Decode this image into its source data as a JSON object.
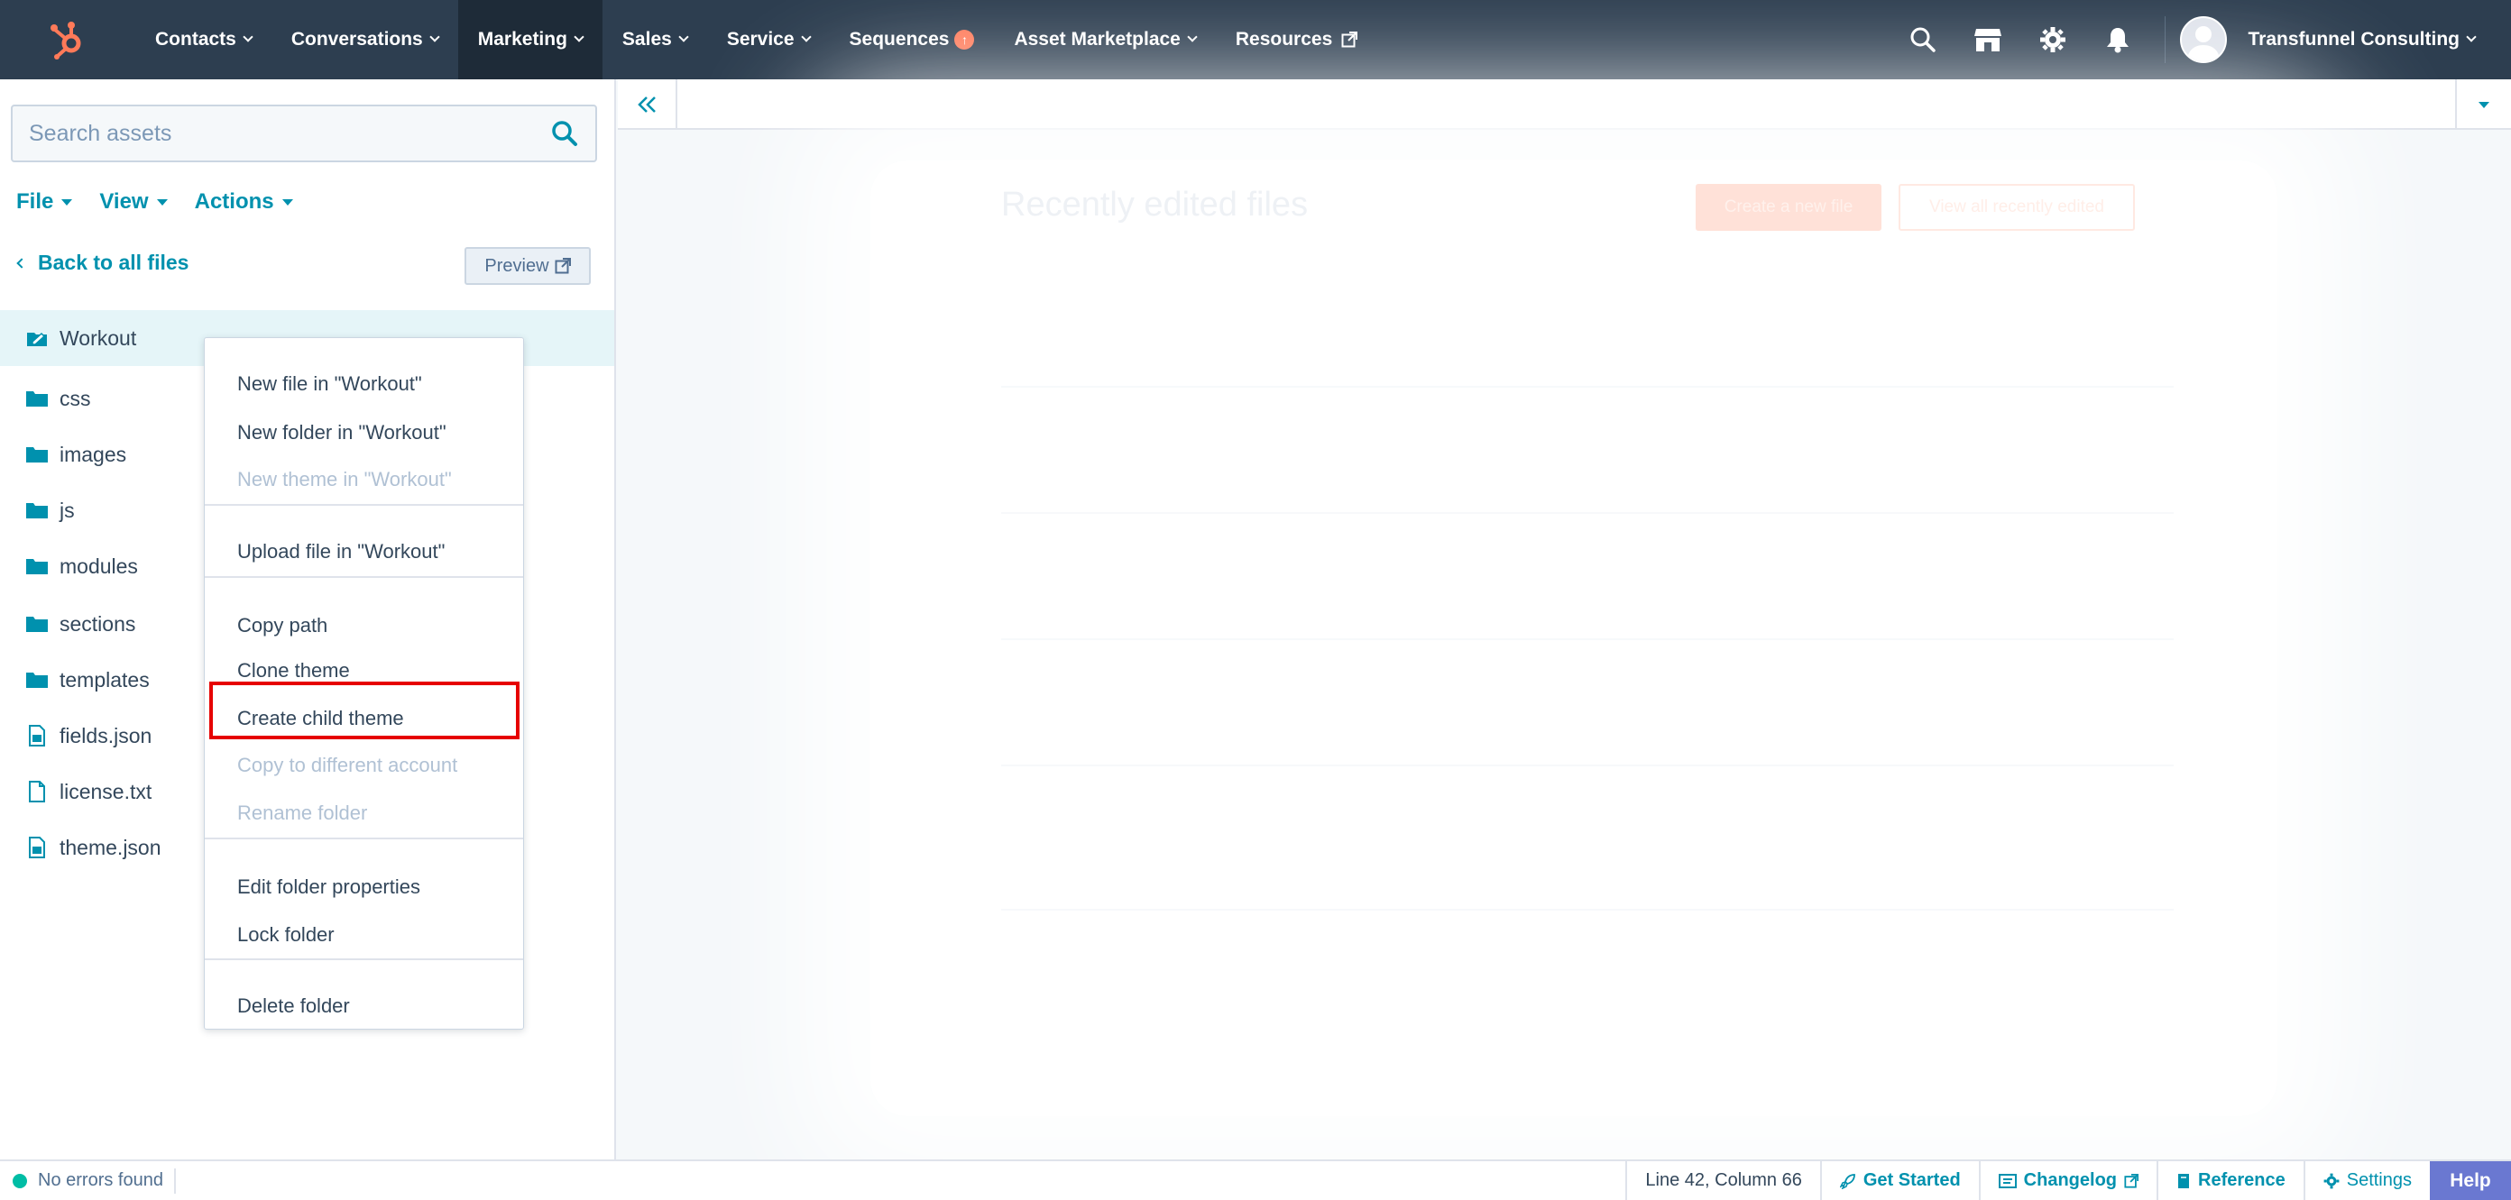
{
  "nav": {
    "items": [
      {
        "label": "Contacts",
        "caret": true
      },
      {
        "label": "Conversations",
        "caret": true
      },
      {
        "label": "Marketing",
        "caret": true,
        "active": true
      },
      {
        "label": "Sales",
        "caret": true
      },
      {
        "label": "Service",
        "caret": true
      },
      {
        "label": "Sequences",
        "badge": true
      },
      {
        "label": "Asset Marketplace",
        "caret": true
      },
      {
        "label": "Resources",
        "external": true
      }
    ],
    "account_name": "Transfunnel Consulting",
    "icons": [
      "search-icon",
      "marketplace-icon",
      "settings-gear-icon",
      "notifications-bell-icon"
    ]
  },
  "sidebar": {
    "search_placeholder": "Search assets",
    "menus": [
      "File",
      "View",
      "Actions"
    ],
    "back_label": "Back to all files",
    "preview_label": "Preview",
    "tree": [
      {
        "label": "Workout",
        "type": "theme"
      },
      {
        "label": "css",
        "type": "folder"
      },
      {
        "label": "images",
        "type": "folder"
      },
      {
        "label": "js",
        "type": "folder"
      },
      {
        "label": "modules",
        "type": "folder"
      },
      {
        "label": "sections",
        "type": "folder"
      },
      {
        "label": "templates",
        "type": "folder"
      },
      {
        "label": "fields.json",
        "type": "json"
      },
      {
        "label": "license.txt",
        "type": "file"
      },
      {
        "label": "theme.json",
        "type": "json"
      }
    ]
  },
  "context_menu": {
    "groups": [
      [
        {
          "label": "New file in \"Workout\"",
          "enabled": true
        },
        {
          "label": "New folder in \"Workout\"",
          "enabled": true
        },
        {
          "label": "New theme in \"Workout\"",
          "enabled": false
        }
      ],
      [
        {
          "label": "Upload file in \"Workout\"",
          "enabled": true
        }
      ],
      [
        {
          "label": "Copy path",
          "enabled": true
        },
        {
          "label": "Clone theme",
          "enabled": true
        },
        {
          "label": "Create child theme",
          "enabled": true,
          "highlighted": true
        },
        {
          "label": "Copy to different account",
          "enabled": false
        },
        {
          "label": "Rename folder",
          "enabled": false
        }
      ],
      [
        {
          "label": "Edit folder properties",
          "enabled": true
        },
        {
          "label": "Lock folder",
          "enabled": true
        }
      ],
      [
        {
          "label": "Delete folder",
          "enabled": true
        }
      ]
    ]
  },
  "main": {
    "ghost_title": "Recently edited files",
    "ghost_primary_button": "Create a new file",
    "ghost_secondary_button": "View all recently edited"
  },
  "statusbar": {
    "errors": "No errors found",
    "cursor": "Line 42, Column 66",
    "get_started": "Get Started",
    "changelog": "Changelog",
    "reference": "Reference",
    "settings": "Settings",
    "help": "Help"
  },
  "colors": {
    "nav_bg": "#2d3e50",
    "accent": "#0091ae",
    "hubspot_orange": "#ff7a59",
    "highlight_red": "#e60000",
    "help_purple": "#6a78d1"
  }
}
